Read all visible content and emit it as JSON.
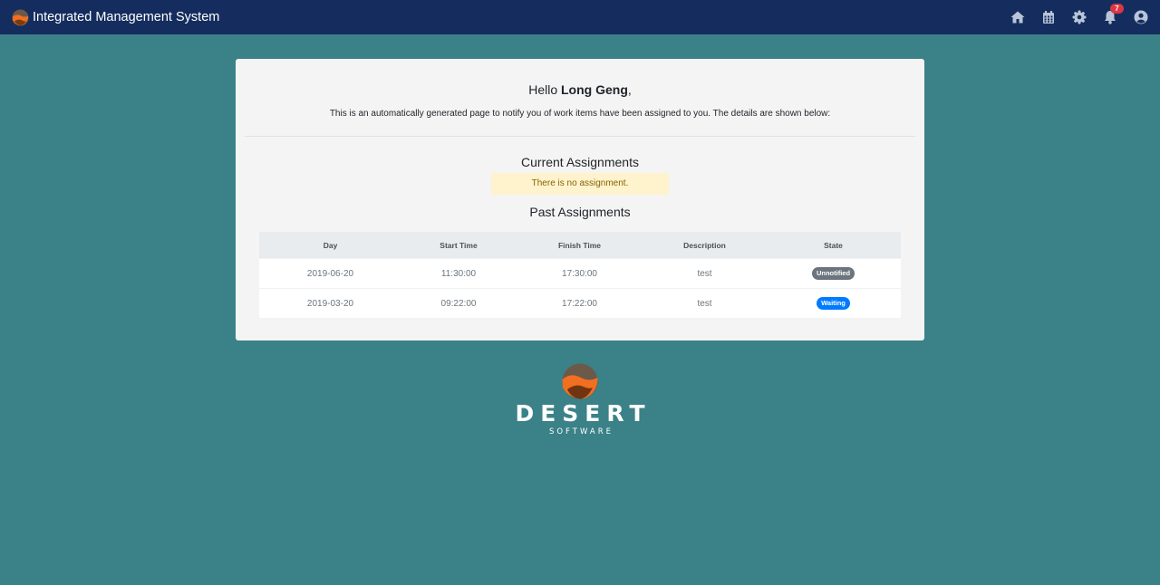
{
  "header": {
    "title": "Integrated Management System",
    "notification_count": "7",
    "icons": [
      "home-icon",
      "calendar-icon",
      "gear-icon",
      "bell-icon",
      "user-icon"
    ]
  },
  "card": {
    "greeting_prefix": "Hello ",
    "user_name": "Long Geng",
    "greeting_suffix": ",",
    "intro": "This is an automatically generated page to notify you of work items have been assigned to you. The details are shown below:",
    "current_title": "Current Assignments",
    "no_assignment": "There is no assignment.",
    "past_title": "Past Assignments",
    "table": {
      "headers": [
        "Day",
        "Start Time",
        "Finish Time",
        "Description",
        "State"
      ],
      "rows": [
        {
          "day": "2019-06-20",
          "start": "11:30:00",
          "finish": "17:30:00",
          "description": "test",
          "state": "Unnotified",
          "state_color": "#6c757d"
        },
        {
          "day": "2019-03-20",
          "start": "09:22:00",
          "finish": "17:22:00",
          "description": "test",
          "state": "Waiting",
          "state_color": "#007bff"
        }
      ]
    }
  },
  "footer": {
    "logo_word": "DESERT",
    "logo_sub": "SOFTWARE"
  },
  "colors": {
    "background": "#3b8188",
    "navbar": "#142d5e",
    "card": "#f4f4f5",
    "alert_bg": "#fff3cd",
    "alert_text": "#856404"
  }
}
